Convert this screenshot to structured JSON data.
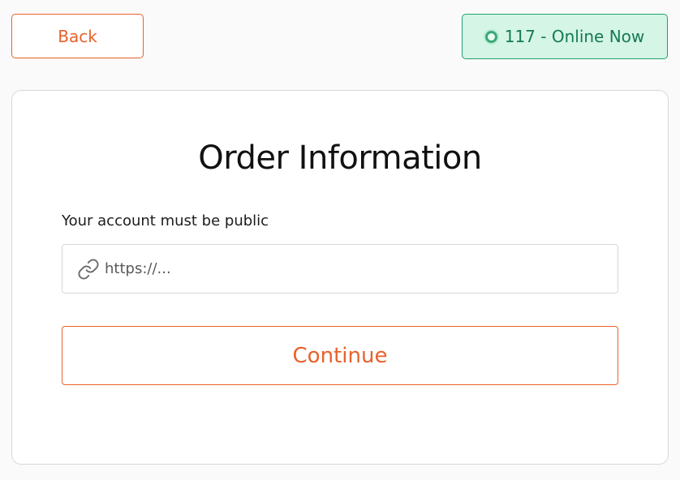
{
  "header": {
    "back_label": "Back",
    "online_status": "117 - Online Now"
  },
  "order_form": {
    "title": "Order Information",
    "account_note": "Your account must be public",
    "url_field": {
      "value": "",
      "placeholder": "https://..."
    },
    "continue_label": "Continue"
  },
  "icons": {
    "status": "online-dot-icon",
    "url": "link-icon"
  },
  "colors": {
    "accent": "#e8622a",
    "online_text": "#157a52",
    "online_background": "#d5f5e6"
  }
}
